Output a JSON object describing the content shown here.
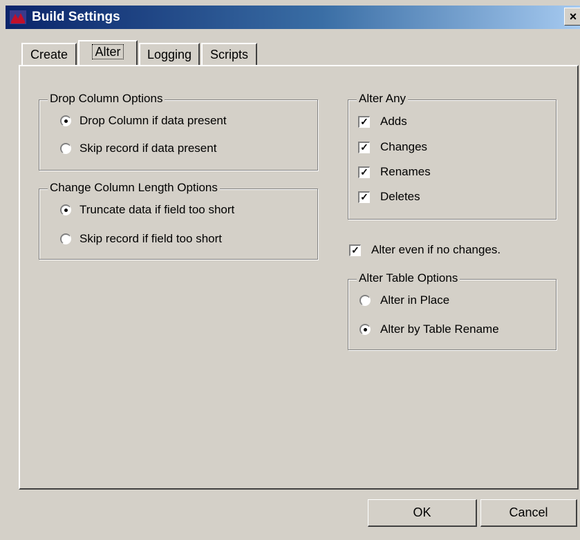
{
  "window": {
    "title": "Build Settings",
    "close_label": "×"
  },
  "tabs": [
    {
      "label": "Create"
    },
    {
      "label": "Alter"
    },
    {
      "label": "Logging"
    },
    {
      "label": "Scripts"
    }
  ],
  "drop_column": {
    "title": "Drop Column Options",
    "options": [
      {
        "label": "Drop Column if data present",
        "selected": true
      },
      {
        "label": "Skip record if data present",
        "selected": false
      }
    ]
  },
  "change_length": {
    "title": "Change Column Length Options",
    "options": [
      {
        "label": "Truncate data if field too short",
        "selected": true
      },
      {
        "label": "Skip record if field too short",
        "selected": false
      }
    ]
  },
  "alter_any": {
    "title": "Alter Any",
    "items": [
      {
        "label": "Adds",
        "checked": true
      },
      {
        "label": "Changes",
        "checked": true
      },
      {
        "label": "Renames",
        "checked": true
      },
      {
        "label": "Deletes",
        "checked": true
      }
    ]
  },
  "alter_even": {
    "label": "Alter even if no changes.",
    "checked": true
  },
  "alter_table": {
    "title": "Alter Table Options",
    "options": [
      {
        "label": "Alter in Place",
        "selected": false
      },
      {
        "label": "Alter by Table Rename",
        "selected": true
      }
    ]
  },
  "buttons": {
    "ok": "OK",
    "cancel": "Cancel"
  },
  "check_mark": "✓"
}
